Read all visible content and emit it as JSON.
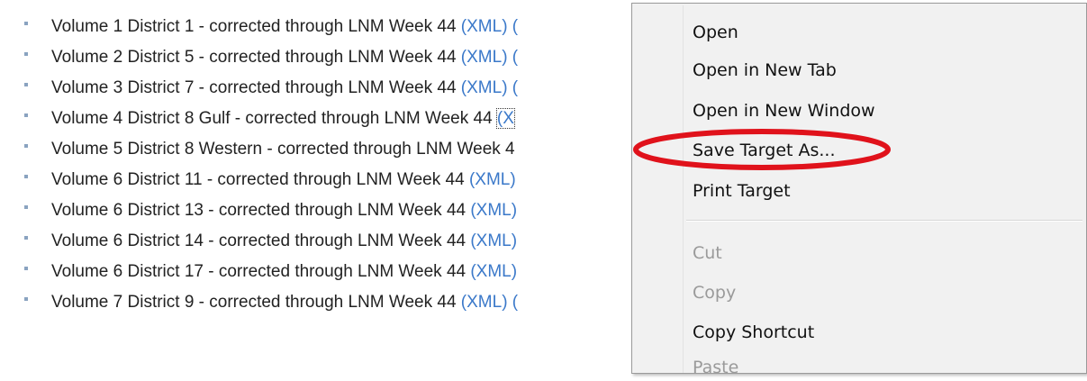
{
  "list": {
    "items": [
      {
        "text": "Volume 1 District 1 - corrected through LNM Week 44 ",
        "link": "(XML)",
        "paren": " ("
      },
      {
        "text": "Volume 2 District 5 - corrected through LNM Week 44 ",
        "link": "(XML)",
        "paren": " ("
      },
      {
        "text": "Volume 3 District 7 - corrected through LNM Week 44 ",
        "link": "(XML)",
        "paren": " ("
      },
      {
        "text": "Volume 4 District 8 Gulf - corrected through LNM Week 44 ",
        "link": "(X",
        "paren": ""
      },
      {
        "text": "Volume 5 District 8 Western - corrected through LNM Week 4",
        "link": "",
        "paren": ""
      },
      {
        "text": "Volume 6 District 11 - corrected through LNM Week 44 ",
        "link": "(XML)",
        "paren": ""
      },
      {
        "text": "Volume 6 District 13 - corrected through LNM Week 44 ",
        "link": "(XML)",
        "paren": ""
      },
      {
        "text": "Volume 6 District 14 - corrected through LNM Week 44 ",
        "link": "(XML)",
        "paren": ""
      },
      {
        "text": "Volume 6 District 17 - corrected through LNM Week 44 ",
        "link": "(XML)",
        "paren": ""
      },
      {
        "text": "Volume 7 District 9 - corrected through LNM Week 44 ",
        "link": "(XML)",
        "paren": " ("
      }
    ]
  },
  "context_menu": {
    "items": [
      {
        "label": "Open",
        "enabled": true
      },
      {
        "label": "Open in New Tab",
        "enabled": true
      },
      {
        "label": "Open in New Window",
        "enabled": true
      },
      {
        "label": "Save Target As...",
        "enabled": true
      },
      {
        "label": "Print Target",
        "enabled": true
      },
      {
        "label": "Cut",
        "enabled": false
      },
      {
        "label": "Copy",
        "enabled": false
      },
      {
        "label": "Copy Shortcut",
        "enabled": true
      },
      {
        "label": "Paste",
        "enabled": false
      }
    ]
  },
  "colors": {
    "link": "#3a78c9",
    "annotation": "#e0121b",
    "menu_background": "#f1f1f1",
    "disabled_text": "#9a9a9a"
  }
}
